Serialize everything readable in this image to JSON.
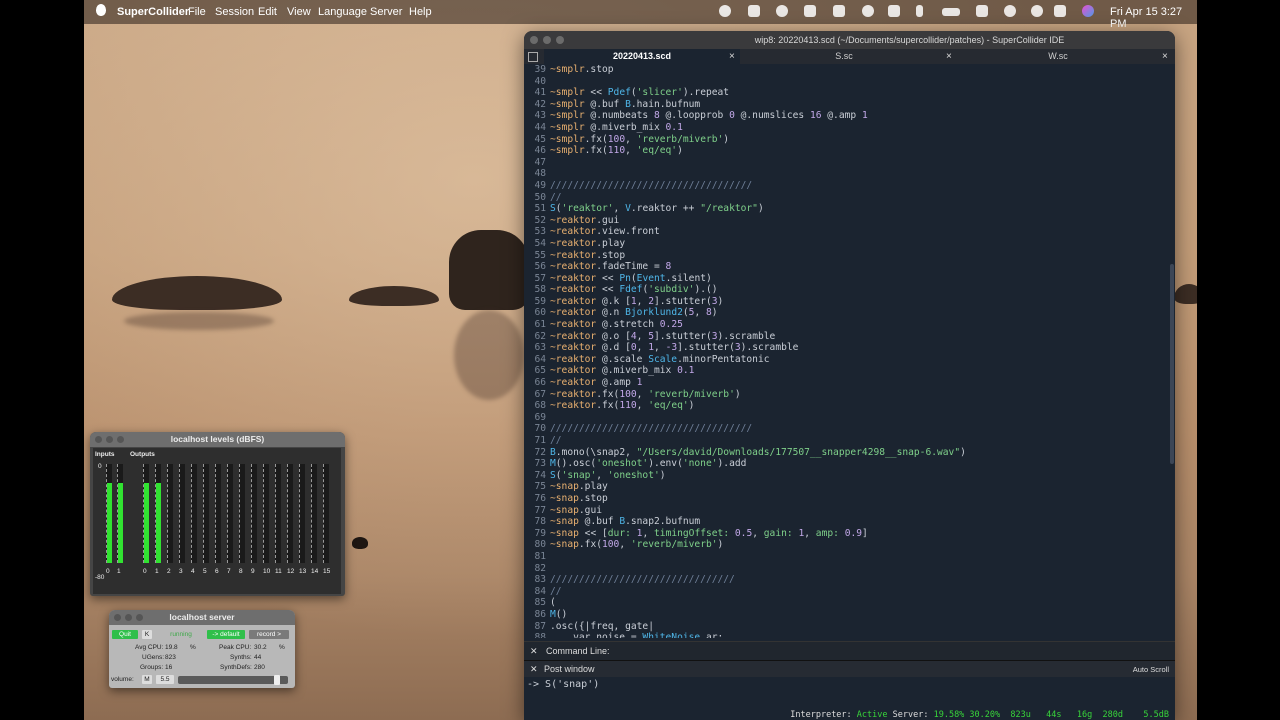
{
  "menubar": {
    "app": "SuperCollider",
    "items": [
      "File",
      "Session",
      "Edit",
      "View",
      "Language",
      "Server",
      "Help"
    ],
    "clock": "Fri Apr 15  3:27 PM"
  },
  "ide": {
    "title": "wip8: 20220413.scd (~/Documents/supercollider/patches) - SuperCollider IDE",
    "tabs": [
      {
        "label": "20220413.scd"
      },
      {
        "label": "S.sc"
      },
      {
        "label": "W.sc"
      }
    ],
    "tab_close": "×",
    "lines": [
      {
        "n": "39",
        "tokens": [
          [
            "env",
            "~smplr"
          ],
          [
            "p",
            ".stop"
          ]
        ]
      },
      {
        "n": "40",
        "tokens": []
      },
      {
        "n": "41",
        "tokens": [
          [
            "env",
            "~smplr"
          ],
          [
            "p",
            " << "
          ],
          [
            "cls",
            "Pdef"
          ],
          [
            "p",
            "("
          ],
          [
            "sym",
            "'slicer'"
          ],
          [
            "p",
            ").repeat"
          ]
        ]
      },
      {
        "n": "42",
        "tokens": [
          [
            "env",
            "~smplr"
          ],
          [
            "p",
            " @.buf "
          ],
          [
            "cls",
            "B"
          ],
          [
            "p",
            ".hain.bufnum"
          ]
        ]
      },
      {
        "n": "43",
        "tokens": [
          [
            "env",
            "~smplr"
          ],
          [
            "p",
            " @.numbeats "
          ],
          [
            "num",
            "8"
          ],
          [
            "p",
            " @.loopprob "
          ],
          [
            "num",
            "0"
          ],
          [
            "p",
            " @.numslices "
          ],
          [
            "num",
            "16"
          ],
          [
            "p",
            " @.amp "
          ],
          [
            "num",
            "1"
          ]
        ]
      },
      {
        "n": "44",
        "tokens": [
          [
            "env",
            "~smplr"
          ],
          [
            "p",
            " @.miverb_mix "
          ],
          [
            "num",
            "0.1"
          ]
        ]
      },
      {
        "n": "45",
        "tokens": [
          [
            "env",
            "~smplr"
          ],
          [
            "p",
            ".fx("
          ],
          [
            "num",
            "100"
          ],
          [
            "p",
            ", "
          ],
          [
            "sym",
            "'reverb/miverb'"
          ],
          [
            "p",
            ")"
          ]
        ]
      },
      {
        "n": "46",
        "tokens": [
          [
            "env",
            "~smplr"
          ],
          [
            "p",
            ".fx("
          ],
          [
            "num",
            "110"
          ],
          [
            "p",
            ", "
          ],
          [
            "sym",
            "'eq/eq'"
          ],
          [
            "p",
            ")"
          ]
        ]
      },
      {
        "n": "47",
        "tokens": []
      },
      {
        "n": "48",
        "tokens": []
      },
      {
        "n": "49",
        "tokens": [
          [
            "cm",
            "///////////////////////////////////"
          ]
        ]
      },
      {
        "n": "50",
        "tokens": [
          [
            "cm",
            "//"
          ]
        ]
      },
      {
        "n": "51",
        "tokens": [
          [
            "cls",
            "S"
          ],
          [
            "p",
            "("
          ],
          [
            "sym",
            "'reaktor'"
          ],
          [
            "p",
            ", "
          ],
          [
            "cls",
            "V"
          ],
          [
            "p",
            ".reaktor ++ "
          ],
          [
            "str",
            "\"/reaktor\""
          ],
          [
            "p",
            ")"
          ]
        ]
      },
      {
        "n": "52",
        "tokens": [
          [
            "env",
            "~reaktor"
          ],
          [
            "p",
            ".gui"
          ]
        ]
      },
      {
        "n": "53",
        "tokens": [
          [
            "env",
            "~reaktor"
          ],
          [
            "p",
            ".view.front"
          ]
        ]
      },
      {
        "n": "54",
        "tokens": [
          [
            "env",
            "~reaktor"
          ],
          [
            "p",
            ".play"
          ]
        ]
      },
      {
        "n": "55",
        "tokens": [
          [
            "env",
            "~reaktor"
          ],
          [
            "p",
            ".stop"
          ]
        ]
      },
      {
        "n": "56",
        "tokens": [
          [
            "env",
            "~reaktor"
          ],
          [
            "p",
            ".fadeTime = "
          ],
          [
            "num",
            "8"
          ]
        ]
      },
      {
        "n": "57",
        "tokens": [
          [
            "env",
            "~reaktor"
          ],
          [
            "p",
            " << "
          ],
          [
            "cls",
            "Pn"
          ],
          [
            "p",
            "("
          ],
          [
            "cls",
            "Event"
          ],
          [
            "p",
            ".silent)"
          ]
        ]
      },
      {
        "n": "58",
        "tokens": [
          [
            "env",
            "~reaktor"
          ],
          [
            "p",
            " << "
          ],
          [
            "cls",
            "Fdef"
          ],
          [
            "p",
            "("
          ],
          [
            "sym",
            "'subdiv'"
          ],
          [
            "p",
            ").()"
          ]
        ]
      },
      {
        "n": "59",
        "tokens": [
          [
            "env",
            "~reaktor"
          ],
          [
            "p",
            " @.k ["
          ],
          [
            "num",
            "1"
          ],
          [
            "p",
            ", "
          ],
          [
            "num",
            "2"
          ],
          [
            "p",
            "].stutter("
          ],
          [
            "num",
            "3"
          ],
          [
            "p",
            ")"
          ]
        ]
      },
      {
        "n": "60",
        "tokens": [
          [
            "env",
            "~reaktor"
          ],
          [
            "p",
            " @.n "
          ],
          [
            "cls",
            "Bjorklund2"
          ],
          [
            "p",
            "("
          ],
          [
            "num",
            "5"
          ],
          [
            "p",
            ", "
          ],
          [
            "num",
            "8"
          ],
          [
            "p",
            ")"
          ]
        ]
      },
      {
        "n": "61",
        "tokens": [
          [
            "env",
            "~reaktor"
          ],
          [
            "p",
            " @.stretch "
          ],
          [
            "num",
            "0.25"
          ]
        ]
      },
      {
        "n": "62",
        "tokens": [
          [
            "env",
            "~reaktor"
          ],
          [
            "p",
            " @.o ["
          ],
          [
            "num",
            "4"
          ],
          [
            "p",
            ", "
          ],
          [
            "num",
            "5"
          ],
          [
            "p",
            "].stutter("
          ],
          [
            "num",
            "3"
          ],
          [
            "p",
            ").scramble"
          ]
        ]
      },
      {
        "n": "63",
        "tokens": [
          [
            "env",
            "~reaktor"
          ],
          [
            "p",
            " @.d ["
          ],
          [
            "num",
            "0"
          ],
          [
            "p",
            ", "
          ],
          [
            "num",
            "1"
          ],
          [
            "p",
            ", "
          ],
          [
            "num",
            "-3"
          ],
          [
            "p",
            "].stutter("
          ],
          [
            "num",
            "3"
          ],
          [
            "p",
            ").scramble"
          ]
        ]
      },
      {
        "n": "64",
        "tokens": [
          [
            "env",
            "~reaktor"
          ],
          [
            "p",
            " @.scale "
          ],
          [
            "cls",
            "Scale"
          ],
          [
            "p",
            ".minorPentatonic"
          ]
        ]
      },
      {
        "n": "65",
        "tokens": [
          [
            "env",
            "~reaktor"
          ],
          [
            "p",
            " @.miverb_mix "
          ],
          [
            "num",
            "0.1"
          ]
        ]
      },
      {
        "n": "66",
        "tokens": [
          [
            "env",
            "~reaktor"
          ],
          [
            "p",
            " @.amp "
          ],
          [
            "num",
            "1"
          ]
        ]
      },
      {
        "n": "67",
        "tokens": [
          [
            "env",
            "~reaktor"
          ],
          [
            "p",
            ".fx("
          ],
          [
            "num",
            "100"
          ],
          [
            "p",
            ", "
          ],
          [
            "sym",
            "'reverb/miverb'"
          ],
          [
            "p",
            ")"
          ]
        ]
      },
      {
        "n": "68",
        "tokens": [
          [
            "env",
            "~reaktor"
          ],
          [
            "p",
            ".fx("
          ],
          [
            "num",
            "110"
          ],
          [
            "p",
            ", "
          ],
          [
            "sym",
            "'eq/eq'"
          ],
          [
            "p",
            ")"
          ]
        ]
      },
      {
        "n": "69",
        "tokens": []
      },
      {
        "n": "70",
        "tokens": [
          [
            "cm",
            "///////////////////////////////////"
          ]
        ]
      },
      {
        "n": "71",
        "tokens": [
          [
            "cm",
            "//"
          ]
        ]
      },
      {
        "n": "72",
        "tokens": [
          [
            "cls",
            "B"
          ],
          [
            "p",
            ".mono(\\snap2, "
          ],
          [
            "str",
            "\"/Users/david/Downloads/177507__snapper4298__snap-6.wav\""
          ],
          [
            "p",
            ")"
          ]
        ]
      },
      {
        "n": "73",
        "tokens": [
          [
            "cls",
            "M"
          ],
          [
            "p",
            "().osc("
          ],
          [
            "sym",
            "'oneshot'"
          ],
          [
            "p",
            ").env("
          ],
          [
            "sym",
            "'none'"
          ],
          [
            "p",
            ").add"
          ]
        ]
      },
      {
        "n": "74",
        "tokens": [
          [
            "cls",
            "S"
          ],
          [
            "p",
            "("
          ],
          [
            "sym",
            "'snap'"
          ],
          [
            "p",
            ", "
          ],
          [
            "sym",
            "'oneshot'"
          ],
          [
            "p",
            ")"
          ]
        ]
      },
      {
        "n": "75",
        "tokens": [
          [
            "env",
            "~snap"
          ],
          [
            "p",
            ".play"
          ]
        ]
      },
      {
        "n": "76",
        "tokens": [
          [
            "env",
            "~snap"
          ],
          [
            "p",
            ".stop"
          ]
        ]
      },
      {
        "n": "77",
        "tokens": [
          [
            "env",
            "~snap"
          ],
          [
            "p",
            ".gui"
          ]
        ]
      },
      {
        "n": "78",
        "tokens": [
          [
            "env",
            "~snap"
          ],
          [
            "p",
            " @.buf "
          ],
          [
            "cls",
            "B"
          ],
          [
            "p",
            ".snap2.bufnum"
          ]
        ]
      },
      {
        "n": "79",
        "tokens": [
          [
            "env",
            "~snap"
          ],
          [
            "p",
            " << ["
          ],
          [
            "sym",
            "dur:"
          ],
          [
            "p",
            " "
          ],
          [
            "num",
            "1"
          ],
          [
            "p",
            ", "
          ],
          [
            "sym",
            "timingOffset:"
          ],
          [
            "p",
            " "
          ],
          [
            "num",
            "0.5"
          ],
          [
            "p",
            ", "
          ],
          [
            "sym",
            "gain:"
          ],
          [
            "p",
            " "
          ],
          [
            "num",
            "1"
          ],
          [
            "p",
            ", "
          ],
          [
            "sym",
            "amp:"
          ],
          [
            "p",
            " "
          ],
          [
            "num",
            "0.9"
          ],
          [
            "p",
            "]"
          ]
        ]
      },
      {
        "n": "80",
        "tokens": [
          [
            "env",
            "~snap"
          ],
          [
            "p",
            ".fx("
          ],
          [
            "num",
            "100"
          ],
          [
            "p",
            ", "
          ],
          [
            "sym",
            "'reverb/miverb'"
          ],
          [
            "p",
            ")"
          ]
        ]
      },
      {
        "n": "81",
        "tokens": []
      },
      {
        "n": "82",
        "tokens": []
      },
      {
        "n": "83",
        "tokens": [
          [
            "cm",
            "////////////////////////////////"
          ]
        ]
      },
      {
        "n": "84",
        "tokens": [
          [
            "cm",
            "//"
          ]
        ]
      },
      {
        "n": "85",
        "tokens": [
          [
            "p",
            "("
          ]
        ]
      },
      {
        "n": "86",
        "tokens": [
          [
            "cls",
            "M"
          ],
          [
            "p",
            "()"
          ]
        ]
      },
      {
        "n": "87",
        "tokens": [
          [
            "p",
            ".osc({|freq, gate|"
          ]
        ]
      },
      {
        "n": "88",
        "tokens": [
          [
            "p",
            "    var noise = "
          ],
          [
            "cls",
            "WhiteNoise"
          ],
          [
            "p",
            ".ar;"
          ]
        ]
      }
    ],
    "command_line_label": "Command Line:",
    "post_window_label": "Post window",
    "auto_scroll_label": "Auto Scroll",
    "post_output": "-> S('snap')",
    "status": {
      "interpreter_label": "Interpreter:",
      "interpreter_state": "Active",
      "server_label": "Server:",
      "server_values": "19.58% 30.20%  823u   44s   16g  280d    5.5dB"
    }
  },
  "levels": {
    "title": "localhost levels (dBFS)",
    "inputs_label": "Inputs",
    "outputs_label": "Outputs",
    "top_db": "0",
    "bottom_db": "-80",
    "input_channels": [
      "0",
      "1"
    ],
    "output_channels": [
      "0",
      "1",
      "2",
      "3",
      "4",
      "5",
      "6",
      "7",
      "8",
      "9",
      "10",
      "11",
      "12",
      "13",
      "14",
      "15"
    ],
    "input_levels": [
      0.81,
      0.81
    ],
    "output_levels": [
      0.81,
      0.81,
      0,
      0,
      0,
      0,
      0,
      0,
      0,
      0,
      0,
      0,
      0,
      0,
      0,
      0
    ]
  },
  "server": {
    "title": "localhost server",
    "quit": "Quit",
    "k": "K",
    "running": "running",
    "default": "-> default",
    "record": "record >",
    "avg_cpu_label": "Avg CPU:",
    "avg_cpu_value": "19.8",
    "percent": "%",
    "peak_cpu_label": "Peak CPU:",
    "peak_cpu_value": "30.2",
    "ugens_label": "UGens:",
    "ugens_value": "823",
    "synths_label": "Synths:",
    "synths_value": "44",
    "groups_label": "Groups:",
    "groups_value": "16",
    "synthdefs_label": "SynthDefs:",
    "synthdefs_value": "280",
    "volume_label": "volume:",
    "mute": "M",
    "volume_value": "5.5",
    "volume_level": 0.92
  }
}
